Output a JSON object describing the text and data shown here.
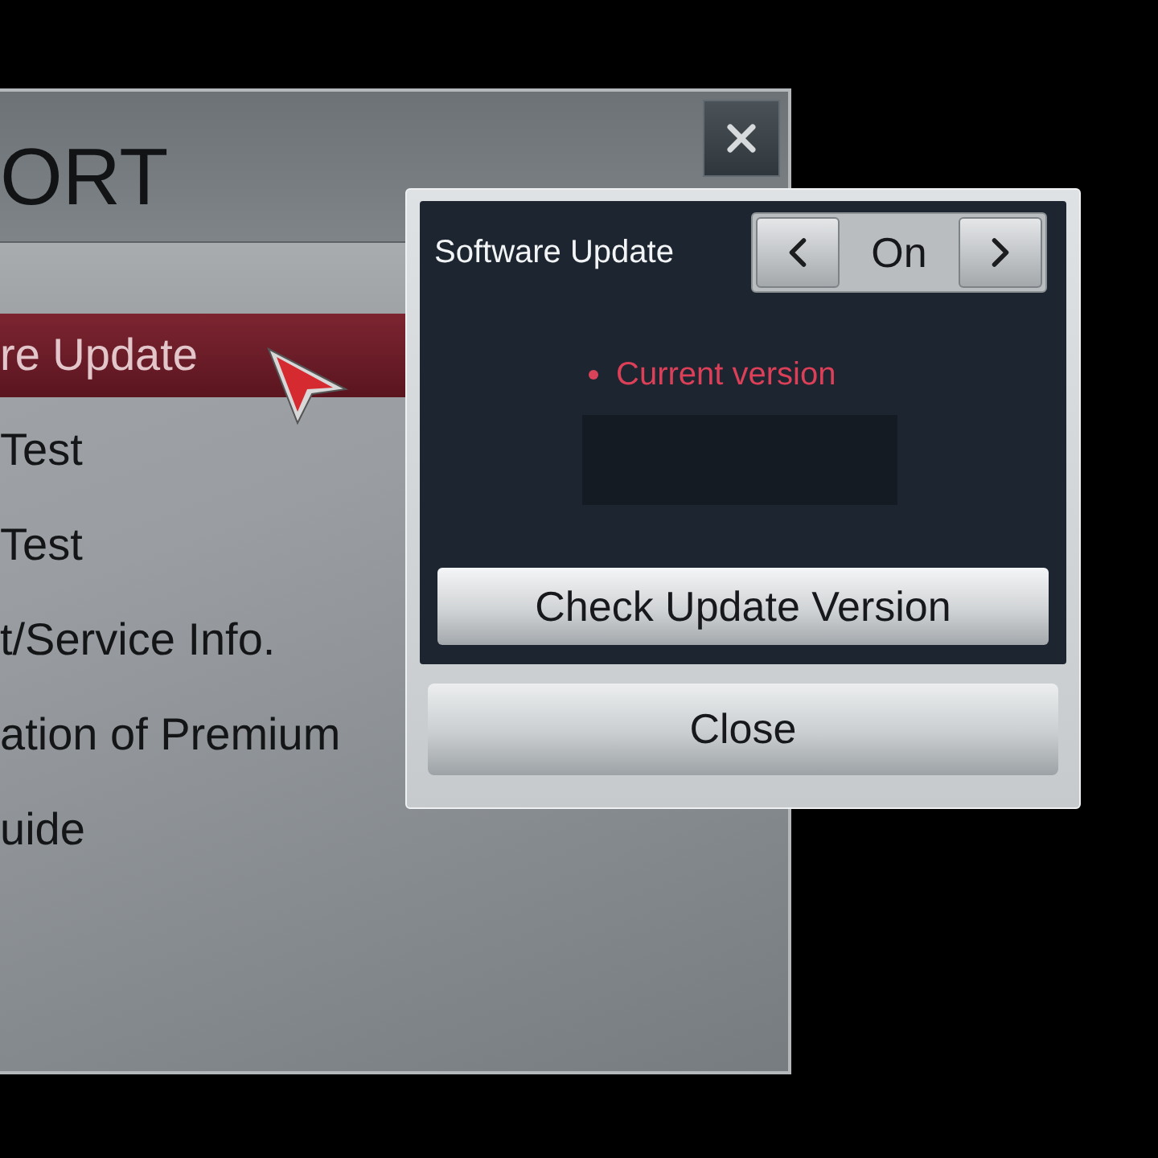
{
  "panel": {
    "title": "ORT"
  },
  "menu": {
    "items": [
      {
        "label": "re Update",
        "selected": true
      },
      {
        "label": "Test",
        "selected": false
      },
      {
        "label": "Test",
        "selected": false
      },
      {
        "label": "t/Service Info.",
        "selected": false
      },
      {
        "label": "ation of Premium",
        "selected": false
      },
      {
        "label": "uide",
        "selected": false
      }
    ]
  },
  "dialog": {
    "setting": {
      "label": "Software Update",
      "value": "On"
    },
    "current_version_label": "Current version",
    "check_button": "Check Update Version",
    "close_button": "Close"
  }
}
